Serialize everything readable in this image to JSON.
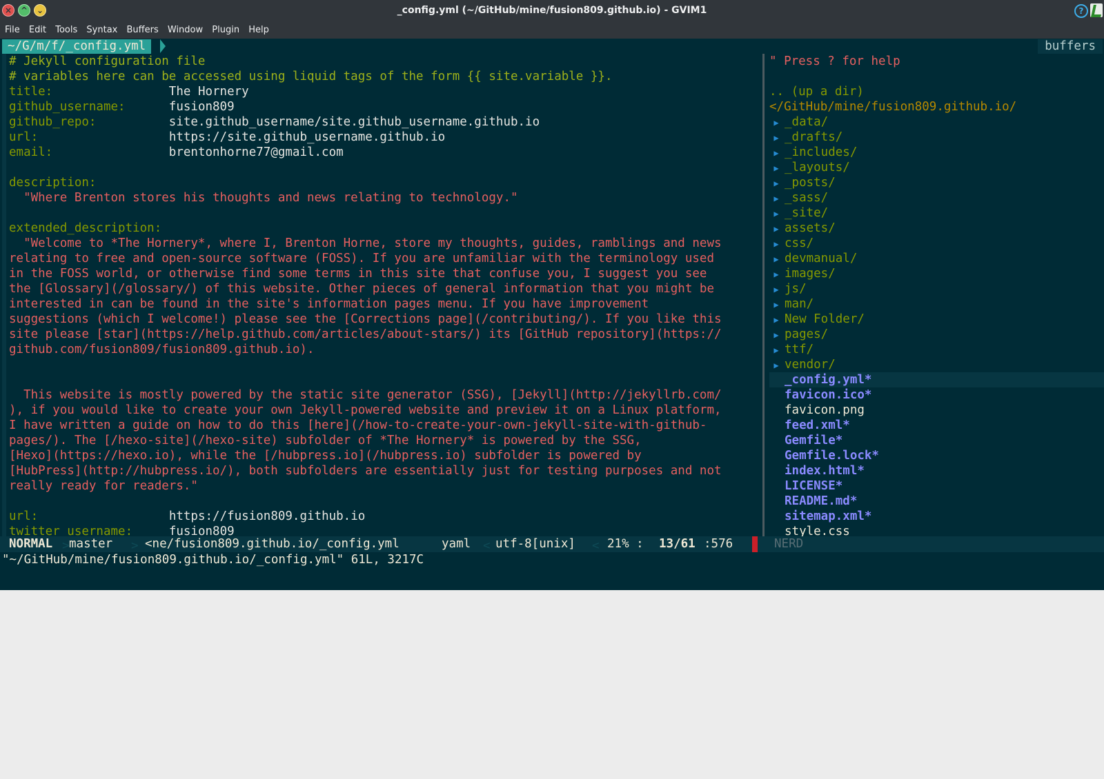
{
  "window": {
    "title": "_config.yml (~/GitHub/mine/fusion809.github.io) - GVIM1",
    "buttons": {
      "close": "×",
      "maximize": "^",
      "minimize": "⌄",
      "help": "?"
    }
  },
  "menubar": [
    "File",
    "Edit",
    "Tools",
    "Syntax",
    "Buffers",
    "Window",
    "Plugin",
    "Help"
  ],
  "tabline": {
    "tab_label": "~/G/m/f/_config.yml",
    "buffers_label": "buffers"
  },
  "editor": {
    "lines": [
      {
        "type": "comment",
        "text": "# Jekyll configuration file"
      },
      {
        "type": "comment",
        "text": "# variables here can be accessed using liquid tags of the form {{ site.variable }}."
      },
      {
        "type": "kv",
        "key": "title:",
        "pad": "                ",
        "value": "The Hornery"
      },
      {
        "type": "kv",
        "key": "github_username:",
        "pad": "      ",
        "value": "fusion809"
      },
      {
        "type": "kv",
        "key": "github_repo:",
        "pad": "          ",
        "value": "site.github_username/site.github_username.github.io"
      },
      {
        "type": "kv",
        "key": "url:",
        "pad": "                  ",
        "value": "https://site.github_username.github.io"
      },
      {
        "type": "kv",
        "key": "email:",
        "pad": "                ",
        "value": "brentonhorne77@gmail.com"
      },
      {
        "type": "blank",
        "text": ""
      },
      {
        "type": "key",
        "text": "description:"
      },
      {
        "type": "string",
        "text": "  \"Where Brenton stores his thoughts and news relating to technology.\""
      },
      {
        "type": "blank",
        "text": ""
      },
      {
        "type": "key",
        "text": "extended_description:"
      },
      {
        "type": "string",
        "text": "  \"Welcome to *The Hornery*, where I, Brenton Horne, store my thoughts, guides, ramblings and news"
      },
      {
        "type": "string",
        "text": "relating to free and open-source software (FOSS). If you are unfamiliar with the terminology used"
      },
      {
        "type": "string",
        "text": "in the FOSS world, or otherwise find some terms in this site that confuse you, I suggest you see"
      },
      {
        "type": "string",
        "text": "the [Glossary](/glossary/) of this website. Other pieces of general information that you might be"
      },
      {
        "type": "string",
        "text": "interested in can be found in the site's information pages menu. If you have improvement"
      },
      {
        "type": "string",
        "text": "suggestions (which I welcome!) please see the [Corrections page](/contributing/). If you like this"
      },
      {
        "type": "string",
        "text": "site please [star](https://help.github.com/articles/about-stars/) its [GitHub repository](https://"
      },
      {
        "type": "string",
        "text": "github.com/fusion809/fusion809.github.io)."
      },
      {
        "type": "blank",
        "text": ""
      },
      {
        "type": "blank",
        "text": ""
      },
      {
        "type": "string",
        "text": "  This website is mostly powered by the static site generator (SSG), [Jekyll](http://jekyllrb.com/"
      },
      {
        "type": "string",
        "text": "), if you would like to create your own Jekyll-powered website and preview it on a Linux platform,"
      },
      {
        "type": "string",
        "text": "I have written a guide on how to do this [here](/how-to-create-your-own-jekyll-site-with-github-"
      },
      {
        "type": "string",
        "text": "pages/). The [/hexo-site](/hexo-site) subfolder of *The Hornery* is powered by the SSG,"
      },
      {
        "type": "string",
        "text": "[Hexo](https://hexo.io), while the [/hubpress.io](/hubpress.io) subfolder is powered by"
      },
      {
        "type": "string",
        "text": "[HubPress](http://hubpress.io/), both subfolders are essentially just for testing purposes and not"
      },
      {
        "type": "string",
        "text": "really ready for readers.\""
      },
      {
        "type": "blank",
        "text": ""
      },
      {
        "type": "kv",
        "key": "url:",
        "pad": "                  ",
        "value": "https://fusion809.github.io"
      },
      {
        "type": "kv",
        "key": "twitter_username:",
        "pad": "     ",
        "value": "fusion809"
      }
    ]
  },
  "nerdtree": {
    "help": "\" Press ? for help",
    "up": ".. (up a dir)",
    "root": "</GitHub/mine/fusion809.github.io/",
    "dirs": [
      "_data/",
      "_drafts/",
      "_includes/",
      "_layouts/",
      "_posts/",
      "_sass/",
      "_site/",
      "assets/",
      "css/",
      "devmanual/",
      "images/",
      "js/",
      "man/",
      "New Folder/",
      "pages/",
      "ttf/",
      "vendor/"
    ],
    "arrow": "▶",
    "files": [
      {
        "name": "_config.yml*",
        "kind": "exe",
        "current": true
      },
      {
        "name": "favicon.ico*",
        "kind": "exe"
      },
      {
        "name": "favicon.png",
        "kind": "file"
      },
      {
        "name": "feed.xml*",
        "kind": "exe"
      },
      {
        "name": "Gemfile*",
        "kind": "exe"
      },
      {
        "name": "Gemfile.lock*",
        "kind": "exe"
      },
      {
        "name": "index.html*",
        "kind": "exe"
      },
      {
        "name": "LICENSE*",
        "kind": "exe"
      },
      {
        "name": "README.md*",
        "kind": "exe"
      },
      {
        "name": "sitemap.xml*",
        "kind": "exe"
      },
      {
        "name": "style.css",
        "kind": "file"
      }
    ]
  },
  "statusline": {
    "mode": "NORMAL",
    "branch": "master",
    "filename": "<ne/fusion809.github.io/_config.yml",
    "filetype": "yaml",
    "encoding": "utf-8[unix]",
    "percent": "21% :",
    "position": "13/61",
    "column": ":576",
    "nerd_label": "NERD"
  },
  "cmdline": "\"~/GitHub/mine/fusion809.github.io/_config.yml\" 61L, 3217C",
  "colors": {
    "background": "#002b36",
    "key": "#859900",
    "string": "#e55f5f",
    "directory": "#859900",
    "executable": "#8a8aff",
    "tab_accent": "#2aa198"
  }
}
